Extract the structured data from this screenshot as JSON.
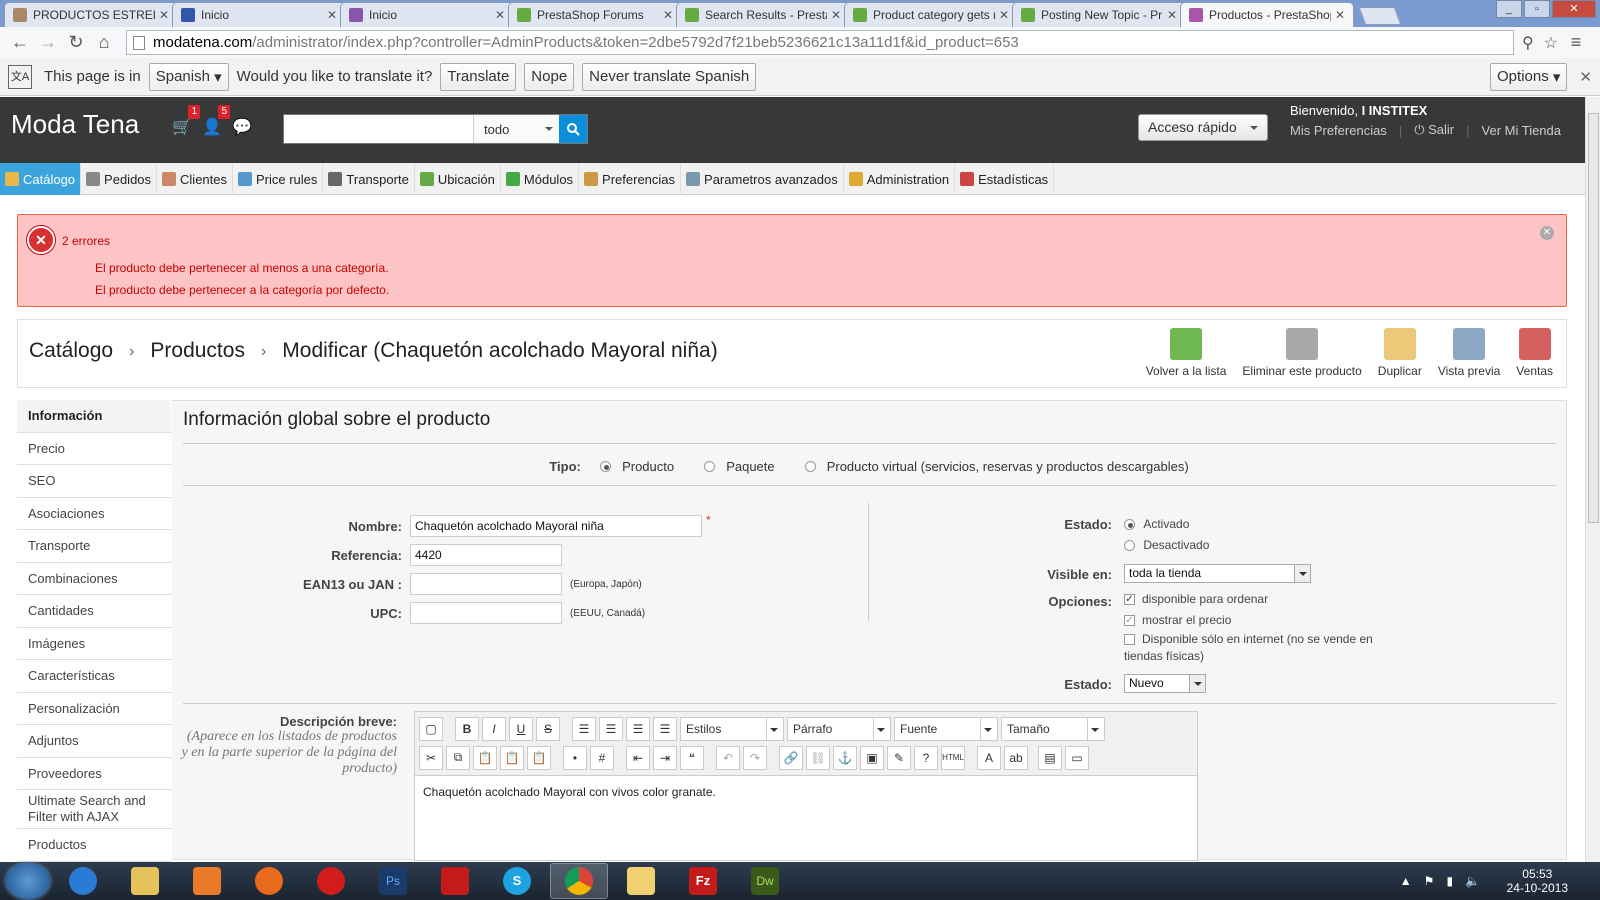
{
  "browser": {
    "tabs": [
      {
        "title": "PRODUCTOS ESTRELLA",
        "icon_color": "#aa8866"
      },
      {
        "title": "Inicio",
        "icon_color": "#3355aa"
      },
      {
        "title": "Inicio",
        "icon_color": "#8855aa"
      },
      {
        "title": "PrestaShop Forums",
        "icon_color": "#66aa44"
      },
      {
        "title": "Search Results - PrestaS",
        "icon_color": "#66aa44"
      },
      {
        "title": "Product category gets n",
        "icon_color": "#66aa44"
      },
      {
        "title": "Posting New Topic - Pr",
        "icon_color": "#66aa44"
      },
      {
        "title": "Productos - PrestaShop",
        "icon_color": "#aa55aa"
      }
    ],
    "url_domain": "modatena.com",
    "url_rest": "/administrator/index.php?controller=AdminProducts&token=2dbe5792d7f21beb5236621c13a11d1f&id_product=653"
  },
  "translate_bar": {
    "prefix": "This page is in",
    "language": "Spanish",
    "question": "Would you like to translate it?",
    "translate": "Translate",
    "nope": "Nope",
    "never": "Never translate Spanish",
    "options": "Options"
  },
  "header": {
    "brand": "Moda Tena",
    "cart_badge": "1",
    "customers_badge": "5",
    "search_scope": "todo",
    "quick_access": "Acceso rápido",
    "welcome": "Bienvenido,",
    "user": "I INSTITEX",
    "prefs": "Mis Preferencias",
    "logout": "Salir",
    "view_store": "Ver Mi Tienda"
  },
  "menu": [
    {
      "label": "Catálogo",
      "color": "#e8b84a"
    },
    {
      "label": "Pedidos",
      "color": "#888"
    },
    {
      "label": "Clientes",
      "color": "#c86"
    },
    {
      "label": "Price rules",
      "color": "#59c"
    },
    {
      "label": "Transporte",
      "color": "#666"
    },
    {
      "label": "Ubicación",
      "color": "#6a4"
    },
    {
      "label": "Módulos",
      "color": "#4a4"
    },
    {
      "label": "Preferencias",
      "color": "#c94"
    },
    {
      "label": "Parametros avanzados",
      "color": "#79a"
    },
    {
      "label": "Administration",
      "color": "#da3"
    },
    {
      "label": "Estadísticas",
      "color": "#c44"
    }
  ],
  "errors": {
    "title": "2 errores",
    "lines": [
      "El producto debe pertenecer al menos a una categoría.",
      "El producto debe pertenecer a la categoría por defecto."
    ]
  },
  "breadcrumb": [
    "Catálogo",
    "Productos",
    "Modificar (Chaquetón acolchado Mayoral niña)"
  ],
  "toolbar": [
    {
      "label": "Volver a la lista",
      "icon": "back-arrow-icon",
      "color": "#5a3"
    },
    {
      "label": "Eliminar este producto",
      "icon": "trash-icon",
      "color": "#999"
    },
    {
      "label": "Duplicar",
      "icon": "duplicate-icon",
      "color": "#e8c060"
    },
    {
      "label": "Vista previa",
      "icon": "preview-icon",
      "color": "#79b"
    },
    {
      "label": "Ventas",
      "icon": "sales-chart-icon",
      "color": "#c44"
    }
  ],
  "sidebar": [
    "Información",
    "Precio",
    "SEO",
    "Asociaciones",
    "Transporte",
    "Combinaciones",
    "Cantidades",
    "Imágenes",
    "Características",
    "Personalización",
    "Adjuntos",
    "Proveedores",
    "Ultimate Search and Filter with AJAX",
    "Productos"
  ],
  "form": {
    "title": "Información global sobre el producto",
    "type_label": "Tipo:",
    "types": [
      "Producto",
      "Paquete",
      "Producto virtual (servicios, reservas y productos descargables)"
    ],
    "name_label": "Nombre:",
    "name_value": "Chaquetón acolchado Mayoral niña",
    "ref_label": "Referencia:",
    "ref_value": "4420",
    "ean_label": "EAN13 ou JAN :",
    "ean_hint": "(Europa, Japón)",
    "upc_label": "UPC:",
    "upc_hint": "(EEUU, Canadá)",
    "state_label": "Estado:",
    "state_on": "Activado",
    "state_off": "Desactivado",
    "visible_label": "Visible en:",
    "visible_value": "toda la tienda",
    "options_label": "Opciones:",
    "opt1": "disponible para ordenar",
    "opt2": "mostrar el precio",
    "opt3a": "Disponible sólo en internet (no se vende en",
    "opt3b": "tiendas físicas)",
    "condition_label": "Estado:",
    "condition_value": "Nuevo",
    "desc_label": "Descripción breve:",
    "desc_hint": "(Aparece en los listados de productos y en la parte superior de la página del producto)",
    "editor_styles": "Estilos",
    "editor_format": "Párrafo",
    "editor_font": "Fuente",
    "editor_size": "Tamaño",
    "desc_text": "Chaquetón acolchado Mayoral con vivos color granate."
  },
  "clock": {
    "time": "05:53",
    "date": "24-10-2013"
  }
}
